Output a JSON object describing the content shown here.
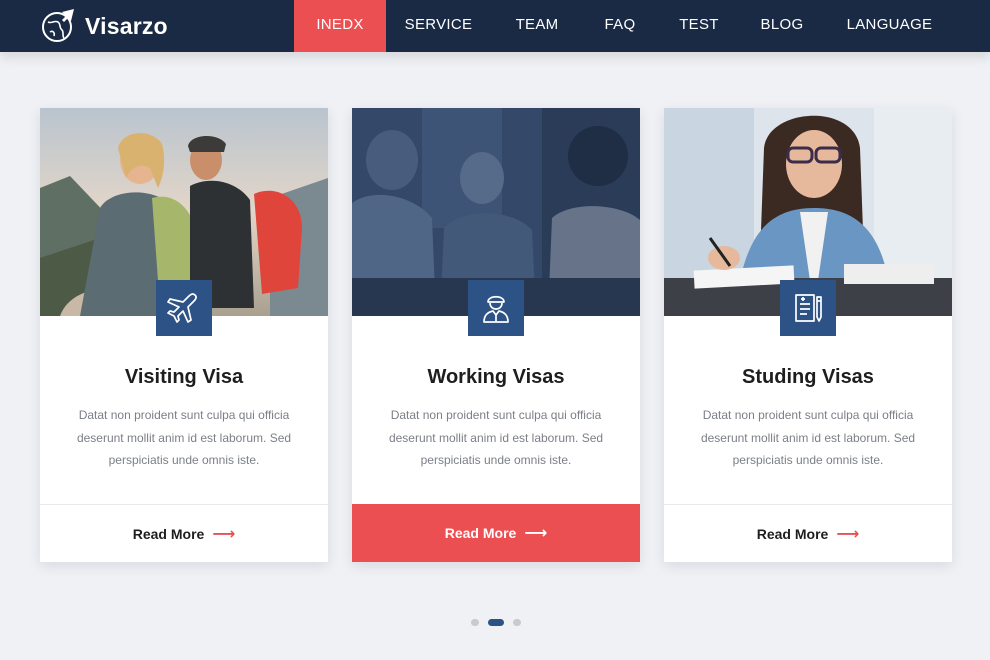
{
  "brand": {
    "name": "Visarzo"
  },
  "nav": {
    "items": [
      {
        "label": "INEDX",
        "active": true
      },
      {
        "label": "SERVICE",
        "active": false
      },
      {
        "label": "TEAM",
        "active": false
      },
      {
        "label": "FAQ",
        "active": false
      },
      {
        "label": "TEST",
        "active": false
      },
      {
        "label": "BLOG",
        "active": false
      },
      {
        "label": "LANGUAGE",
        "active": false
      }
    ]
  },
  "cards": [
    {
      "title": "Visiting Visa",
      "text": "Datat non proident sunt culpa qui officia deserunt mollit anim id est laborum. Sed perspiciatis unde omnis iste.",
      "link": "Read More",
      "icon": "airplane-icon",
      "highlighted": false
    },
    {
      "title": "Working Visas",
      "text": "Datat non proident sunt culpa qui officia deserunt mollit anim id est laborum. Sed perspiciatis unde omnis iste.",
      "link": "Read More",
      "icon": "worker-icon",
      "highlighted": true
    },
    {
      "title": "Studing Visas",
      "text": "Datat non proident sunt culpa qui officia deserunt mollit anim id est laborum. Sed perspiciatis unde omnis iste.",
      "link": "Read More",
      "icon": "notebook-icon",
      "highlighted": false
    }
  ],
  "carousel": {
    "page_count": 3,
    "active_page": 2
  },
  "colors": {
    "header": "#1b2a44",
    "accent": "#ec4f51",
    "badge": "#2d5285",
    "background": "#eff1f5"
  }
}
